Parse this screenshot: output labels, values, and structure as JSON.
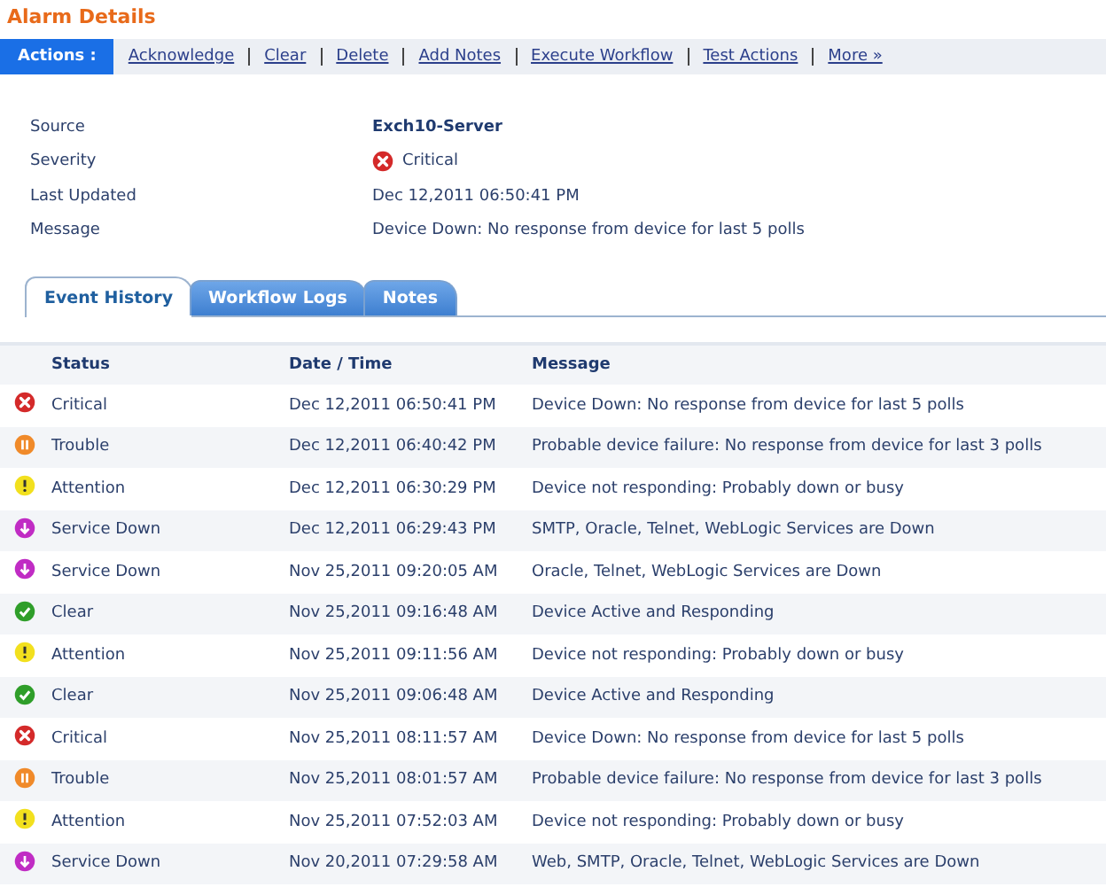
{
  "title": "Alarm Details",
  "actions": {
    "label": "Actions :",
    "links": [
      "Acknowledge",
      "Clear",
      "Delete",
      "Add Notes",
      "Execute Workflow",
      "Test Actions",
      "More »"
    ]
  },
  "details": [
    {
      "label": "Source",
      "value": "Exch10-Server",
      "kind": "bold"
    },
    {
      "label": "Severity",
      "value": "Critical",
      "kind": "critical"
    },
    {
      "label": "Last Updated",
      "value": "Dec 12,2011 06:50:41 PM",
      "kind": "text"
    },
    {
      "label": "Message",
      "value": "Device Down: No response from device for last 5 polls",
      "kind": "text"
    }
  ],
  "tabs": [
    {
      "label": "Event History",
      "selected": true
    },
    {
      "label": "Workflow Logs",
      "selected": false
    },
    {
      "label": "Notes",
      "selected": false
    }
  ],
  "table": {
    "columns": [
      "Status",
      "Date / Time",
      "Message"
    ],
    "rows": [
      {
        "kind": "critical",
        "status": "Critical",
        "time": "Dec 12,2011 06:50:41 PM",
        "message": "Device Down: No response from device for last 5 polls"
      },
      {
        "kind": "trouble",
        "status": "Trouble",
        "time": "Dec 12,2011 06:40:42 PM",
        "message": "Probable device failure: No response from device for last 3 polls"
      },
      {
        "kind": "attention",
        "status": "Attention",
        "time": "Dec 12,2011 06:30:29 PM",
        "message": "Device not responding: Probably down or busy"
      },
      {
        "kind": "service_down",
        "status": "Service Down",
        "time": "Dec 12,2011 06:29:43 PM",
        "message": "SMTP, Oracle, Telnet, WebLogic Services are Down"
      },
      {
        "kind": "service_down",
        "status": "Service Down",
        "time": "Nov 25,2011 09:20:05 AM",
        "message": "Oracle, Telnet, WebLogic Services are Down"
      },
      {
        "kind": "clear",
        "status": "Clear",
        "time": "Nov 25,2011 09:16:48 AM",
        "message": "Device Active and Responding"
      },
      {
        "kind": "attention",
        "status": "Attention",
        "time": "Nov 25,2011 09:11:56 AM",
        "message": "Device not responding: Probably down or busy"
      },
      {
        "kind": "clear",
        "status": "Clear",
        "time": "Nov 25,2011 09:06:48 AM",
        "message": "Device Active and Responding"
      },
      {
        "kind": "critical",
        "status": "Critical",
        "time": "Nov 25,2011 08:11:57 AM",
        "message": "Device Down: No response from device for last 5 polls"
      },
      {
        "kind": "trouble",
        "status": "Trouble",
        "time": "Nov 25,2011 08:01:57 AM",
        "message": "Probable device failure: No response from device for last 3 polls"
      },
      {
        "kind": "attention",
        "status": "Attention",
        "time": "Nov 25,2011 07:52:03 AM",
        "message": "Device not responding: Probably down or busy"
      },
      {
        "kind": "service_down",
        "status": "Service Down",
        "time": "Nov 20,2011 07:29:58 AM",
        "message": "Web, SMTP, Oracle, Telnet, WebLogic Services are Down"
      }
    ]
  }
}
